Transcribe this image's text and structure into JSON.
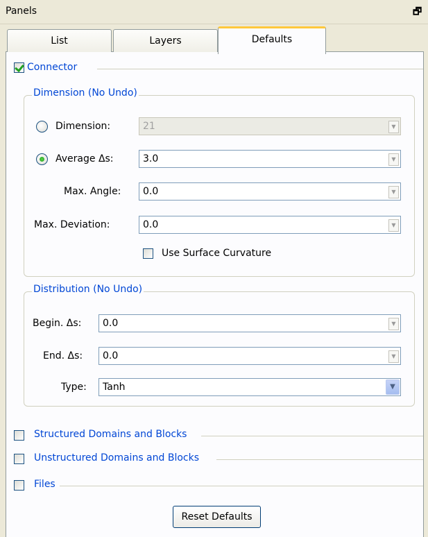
{
  "titlebar": {
    "title": "Panels",
    "float_glyph": "🗗"
  },
  "tabs": [
    {
      "label": "List"
    },
    {
      "label": "Layers"
    },
    {
      "label": "Defaults"
    }
  ],
  "connector": {
    "label": "Connector",
    "checked": true,
    "dimension_group": {
      "title": "Dimension (No Undo)",
      "dimension_label": "Dimension:",
      "dimension_value": "21",
      "average_label": "Average Δs:",
      "average_value": "3.0",
      "max_angle_label": "Max. Angle:",
      "max_angle_value": "0.0",
      "max_dev_label": "Max. Deviation:",
      "max_dev_value": "0.0",
      "surface_curv_label": "Use Surface Curvature"
    },
    "distribution_group": {
      "title": "Distribution (No Undo)",
      "begin_label": "Begin. Δs:",
      "begin_value": "0.0",
      "end_label": "End. Δs:",
      "end_value": "0.0",
      "type_label": "Type:",
      "type_value": "Tanh"
    }
  },
  "sections": {
    "structured": "Structured Domains and Blocks",
    "unstructured": "Unstructured Domains and Blocks",
    "files": "Files"
  },
  "reset_label": "Reset Defaults",
  "colors": {
    "accent_blue": "#0046d5",
    "tab_highlight": "#ffc83c",
    "check_green": "#21a121"
  },
  "icons": {
    "arrow": "spin-arrow-icon",
    "dropdown": "chevron-down-icon",
    "float": "float-window-icon"
  }
}
